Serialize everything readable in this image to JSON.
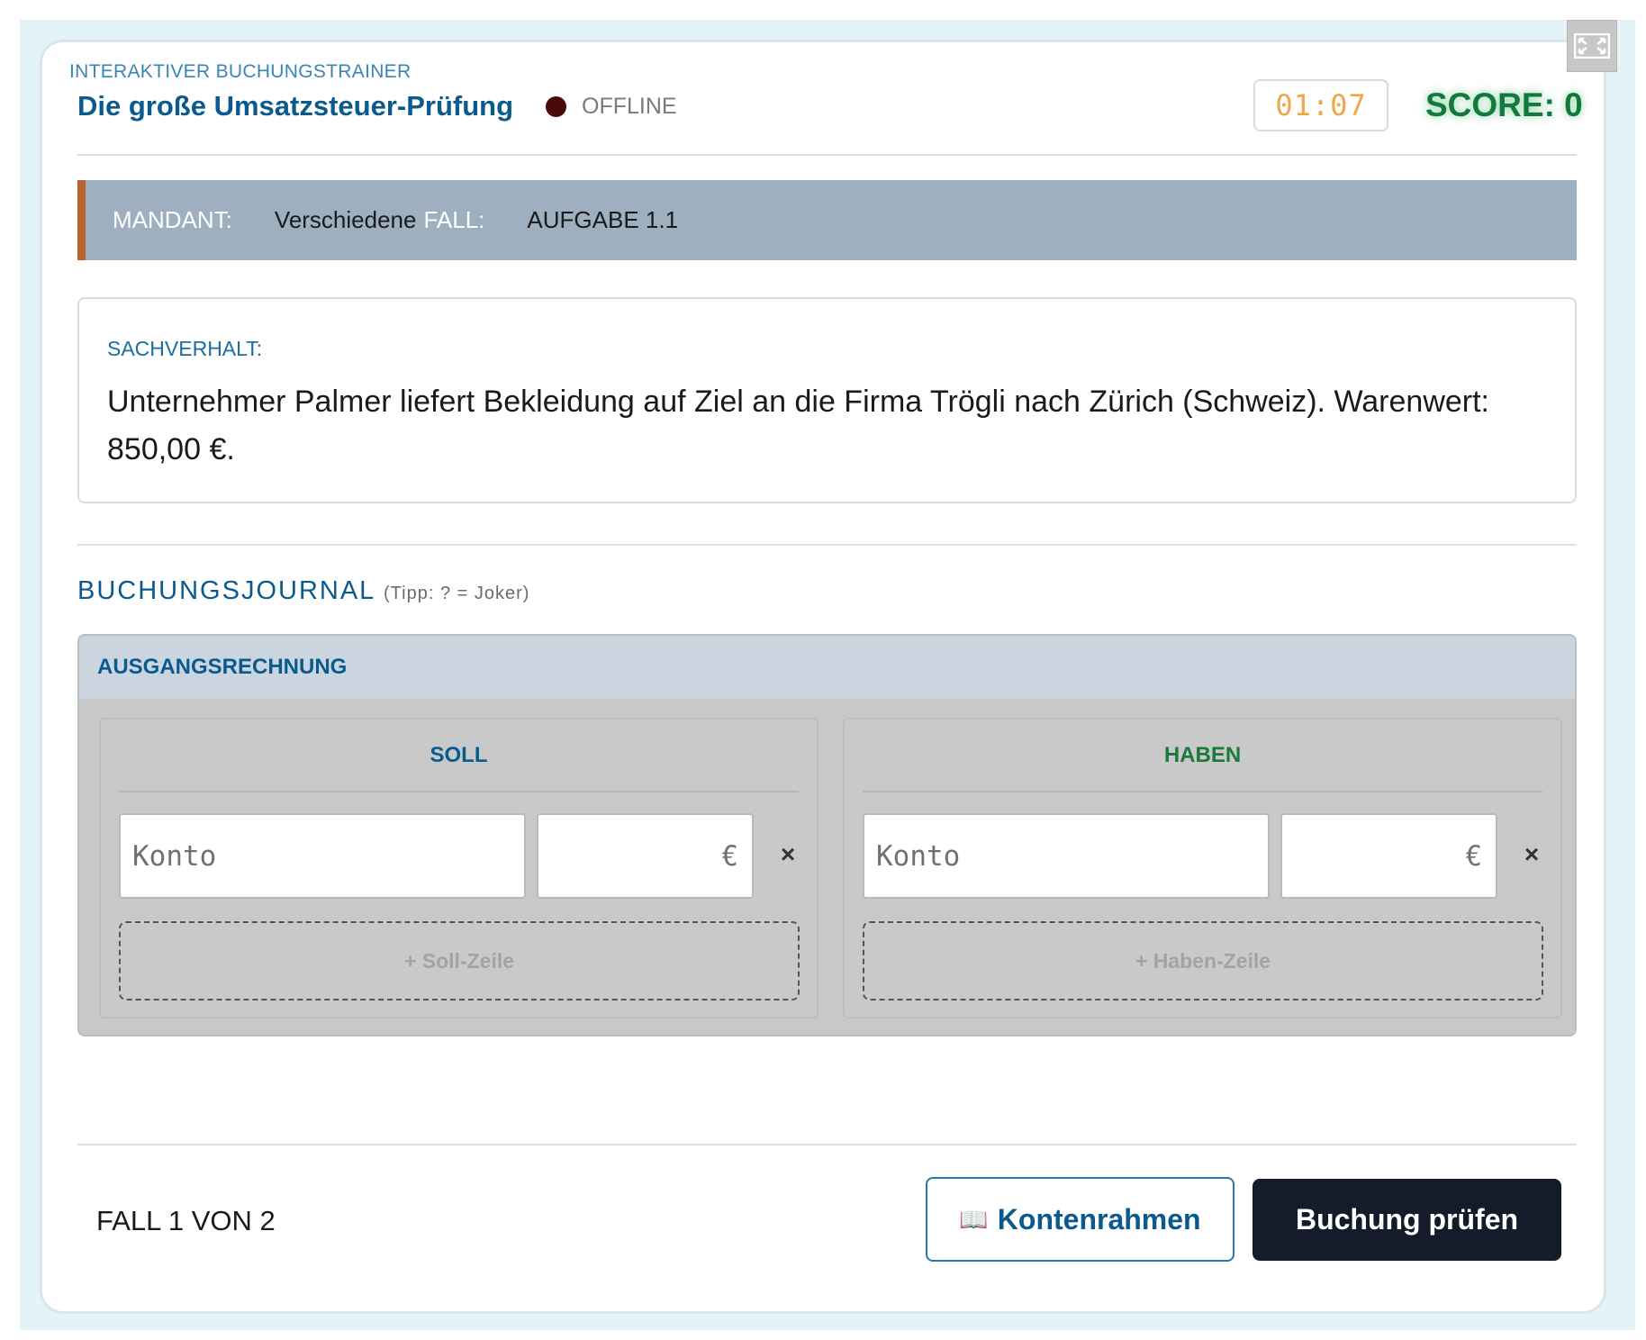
{
  "header": {
    "kicker": "INTERAKTIVER BUCHUNGSTRAINER",
    "title": "Die große Umsatzsteuer-Prüfung",
    "status": "OFFLINE",
    "timer": "01:07",
    "score": "SCORE: 0"
  },
  "info_bar": {
    "mandant_label": "MANDANT:",
    "mandant_value": "Verschiedene",
    "fall_label": "FALL:",
    "fall_value": "AUFGABE 1.1"
  },
  "sachverhalt": {
    "label": "SACHVERHALT:",
    "text": "Unternehmer Palmer liefert Bekleidung auf Ziel an die Firma Trögli nach Zürich (Schweiz). Warenwert: 850,00 €."
  },
  "journal": {
    "title": "BUCHUNGSJOURNAL",
    "tip": "(Tipp: ? = Joker)",
    "section_title": "AUSGANGSRECHNUNG",
    "soll": {
      "heading": "SOLL",
      "konto_placeholder": "Konto",
      "currency": "€",
      "remove": "×",
      "add_row": "+ Soll-Zeile"
    },
    "haben": {
      "heading": "HABEN",
      "konto_placeholder": "Konto",
      "currency": "€",
      "remove": "×",
      "add_row": "+ Haben-Zeile"
    }
  },
  "footer": {
    "progress": "FALL 1 VON 2",
    "kontenrahmen_icon": "📖",
    "kontenrahmen_label": "Kontenrahmen",
    "check_label": "Buchung prüfen"
  },
  "icons": {
    "expand": "expand-icon",
    "status_dot": "status-dot-icon",
    "book": "book-icon",
    "remove": "close-icon"
  },
  "colors": {
    "primary": "#0b5a8e",
    "score_green": "#117a3c",
    "timer_orange": "#f0a64a",
    "haben_green": "#1a7a3c",
    "accent_bar": "#b8622e",
    "dark_button": "#141b2b"
  }
}
